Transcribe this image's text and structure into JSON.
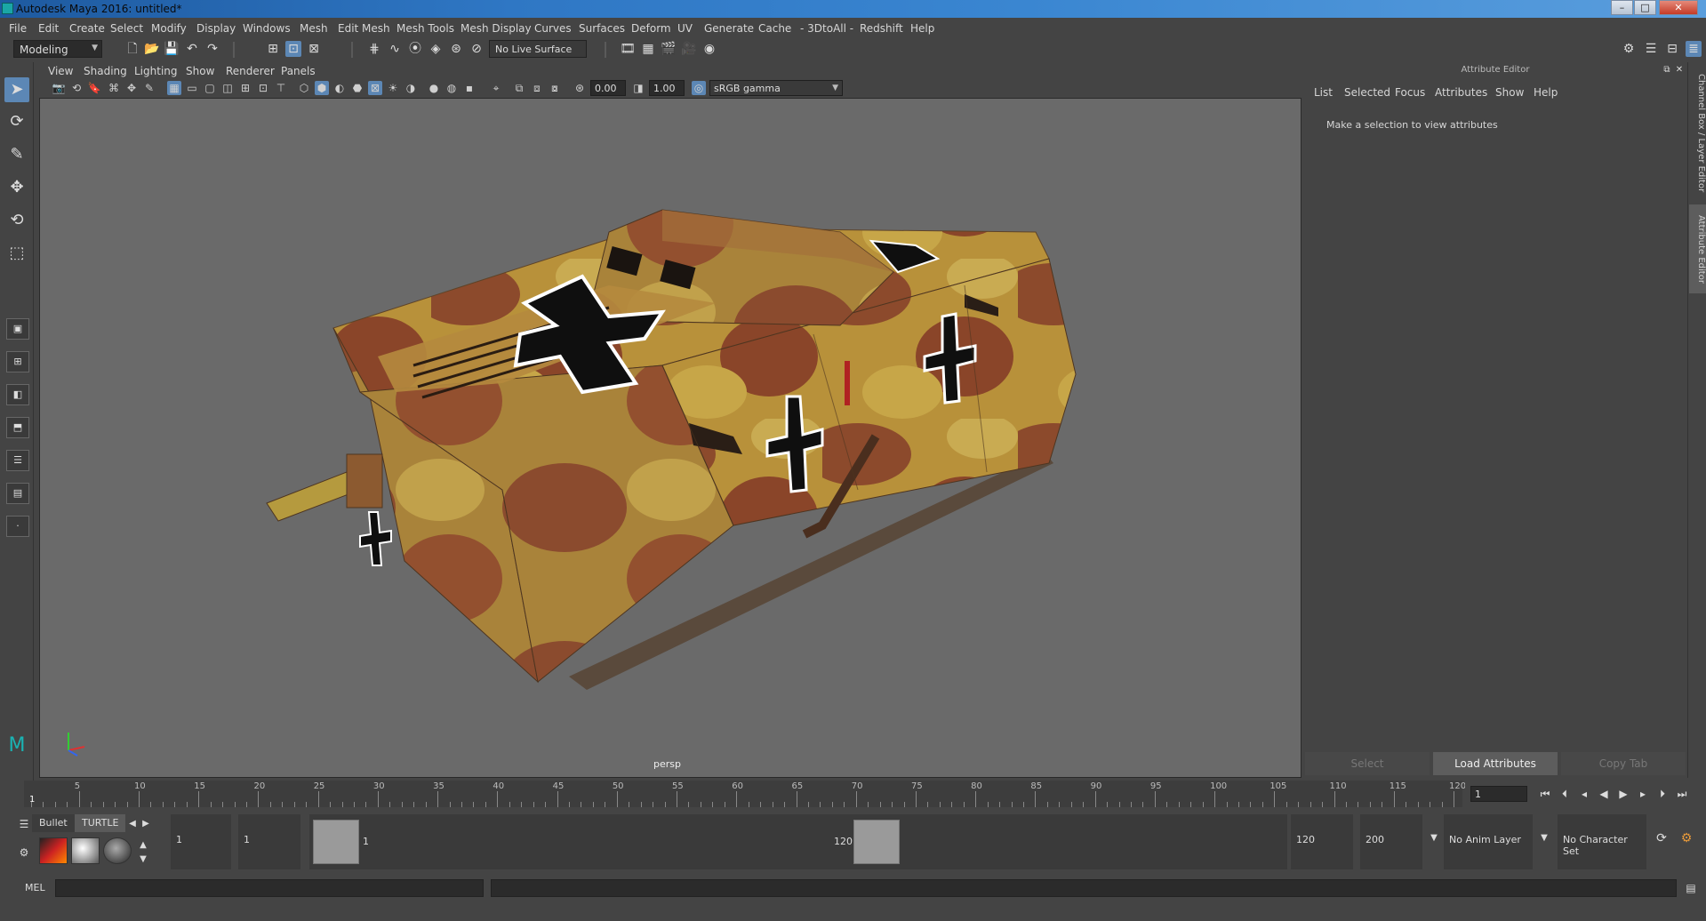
{
  "window": {
    "title": "Autodesk Maya 2016: untitled*",
    "minimize_icon": "minimize-icon",
    "maximize_icon": "maximize-icon",
    "close_icon": "close-icon",
    "min_symbol": "–",
    "max_symbol": "□",
    "close_symbol": "✕"
  },
  "menubar": {
    "items": [
      "File",
      "Edit",
      "Create",
      "Select",
      "Modify",
      "Display",
      "Windows",
      "Mesh",
      "Edit Mesh",
      "Mesh Tools",
      "Mesh Display",
      "Curves",
      "Surfaces",
      "Deform",
      "UV",
      "Generate",
      "Cache",
      "- 3DtoAll -",
      "Redshift",
      "Help"
    ]
  },
  "statusline": {
    "menuset": "Modeling",
    "live_surface": "No Live Surface"
  },
  "panel": {
    "menu": [
      "View",
      "Shading",
      "Lighting",
      "Show",
      "Renderer",
      "Panels"
    ],
    "exposure": "0.00",
    "gamma": "1.00",
    "colorspace": "sRGB gamma",
    "camera": "persp"
  },
  "attribute_editor": {
    "title": "Attribute Editor",
    "menu": [
      "List",
      "Selected",
      "Focus",
      "Attributes",
      "Show",
      "Help"
    ],
    "message": "Make a selection to view attributes",
    "buttons": {
      "select": "Select",
      "load": "Load Attributes",
      "copy": "Copy Tab"
    }
  },
  "side_tabs": [
    "Channel Box / Layer Editor",
    "Attribute Editor"
  ],
  "timeslider": {
    "labels": [
      "5",
      "10",
      "15",
      "20",
      "25",
      "30",
      "35",
      "40",
      "45",
      "50",
      "55",
      "60",
      "65",
      "70",
      "75",
      "80",
      "85",
      "90",
      "95",
      "100",
      "105",
      "110",
      "115",
      "120"
    ],
    "current_frame_marker": "1",
    "current_frame": "1"
  },
  "shelf": {
    "tabs": [
      "Bullet",
      "TURTLE"
    ]
  },
  "range": {
    "start": "1",
    "playback_start": "1",
    "range_start_label": "1",
    "range_end_label": "120",
    "playback_end": "120",
    "end": "200",
    "anim_layer": "No Anim Layer",
    "character_set": "No Character Set"
  },
  "cmdline": {
    "label": "MEL"
  },
  "colors": {
    "accent": "#5c87b5",
    "viewport": "#6a6a6a",
    "ui_bg": "#444444"
  }
}
